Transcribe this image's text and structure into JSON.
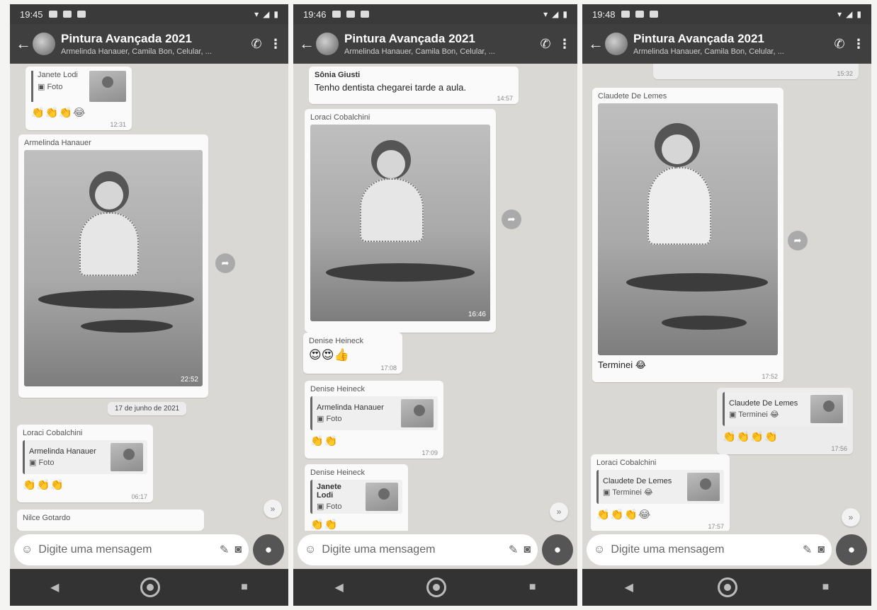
{
  "common": {
    "group_title": "Pintura Avançada 2021",
    "group_members": "Armelinda Hanauer, Camila Bon, Celular, ...",
    "input_placeholder": "Digite uma mensagem",
    "icons": {
      "back": "arrow-left-icon",
      "call": "add-call-icon",
      "menu": "more-vert-icon",
      "emoji": "emoji-icon",
      "attach": "paperclip-icon",
      "camera": "camera-icon",
      "mic": "mic-icon",
      "forward": "forward-icon",
      "scroll": "chevron-double-down-icon"
    }
  },
  "screens": [
    {
      "status_time": "19:45",
      "messages": {
        "m1": {
          "sender": "Janete Lodi",
          "subtitle": "Foto",
          "reactions": "👏👏👏😂",
          "time": "12:31"
        },
        "m2": {
          "sender": "Armelinda Hanauer",
          "time": "22:52"
        },
        "date": "17 de junho de 2021",
        "m3": {
          "sender": "Loraci Cobalchini",
          "quote_name": "Armelinda Hanauer",
          "quote_text": "Foto",
          "reactions": "👏👏👏",
          "time": "06:17"
        },
        "m4": {
          "sender": "Nilce Gotardo"
        }
      }
    },
    {
      "status_time": "19:46",
      "messages": {
        "m1": {
          "sender": "Sônia Giusti",
          "text": "Tenho dentista chegarei tarde a aula.",
          "time": "14:57"
        },
        "m2": {
          "sender": "Loraci Cobalchini",
          "time": "16:46"
        },
        "m3": {
          "sender": "Denise Heineck",
          "text": "😍😍👍",
          "time": "17:08"
        },
        "m4": {
          "sender": "Denise Heineck",
          "quote_name": "Armelinda Hanauer",
          "quote_text": "Foto",
          "reactions": "👏👏",
          "time": "17:09"
        },
        "m5": {
          "sender": "Denise Heineck",
          "quote_name": "Janete Lodi",
          "quote_text": "Foto",
          "reactions": "👏👏"
        }
      }
    },
    {
      "status_time": "19:48",
      "messages": {
        "m0": {
          "time": "15:32"
        },
        "m1": {
          "sender": "Claudete De Lemes",
          "text": "Terminei 😂",
          "time": "17:52"
        },
        "m2": {
          "quote_name": "Claudete De Lemes",
          "quote_text": "Terminei 😂",
          "reactions": "👏👏👏👏",
          "time": "17:56"
        },
        "m3": {
          "sender": "Loraci Cobalchini",
          "quote_name": "Claudete De Lemes",
          "quote_text": "Terminei 😂",
          "reactions": "👏👏👏😂",
          "time": "17:57"
        }
      }
    }
  ]
}
